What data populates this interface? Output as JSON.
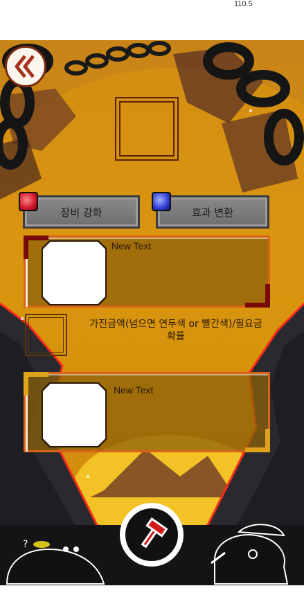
{
  "status_bar": {
    "speed_text": "110.5"
  },
  "header": {
    "back_icon": "double-chevron-left-icon"
  },
  "tabs": [
    {
      "label": "장비 강화",
      "gem_color": "#d2152a"
    },
    {
      "label": "효과 변환",
      "gem_color": "#2f3fd6"
    }
  ],
  "panels": [
    {
      "label": "New Text",
      "corner_color": "#7a0a0a"
    },
    {
      "label": "New Text",
      "corner_color": "#e0a21a"
    }
  ],
  "cost": {
    "line1": "가진금액(넘으면 연두색 or 빨간색)/필요금",
    "line2": "확률"
  },
  "action": {
    "hammer_icon": "hammer-icon"
  },
  "colors": {
    "background": "#cf8d0e",
    "accent": "#d9621a",
    "danger": "#ff2a1a"
  }
}
